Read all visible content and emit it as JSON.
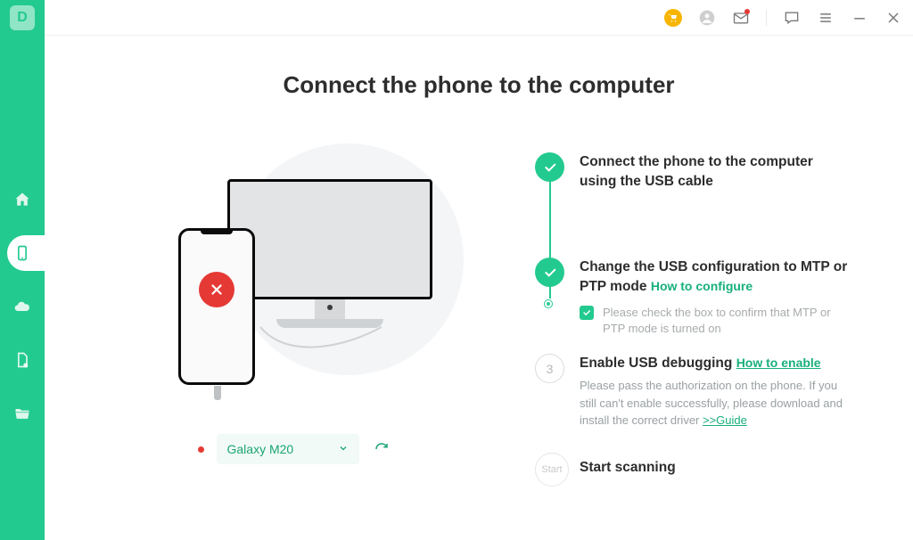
{
  "logo_letter": "D",
  "title": "Connect the phone to the computer",
  "device": {
    "name": "Galaxy M20"
  },
  "steps": {
    "s1": {
      "title": "Connect the phone to the computer using the USB cable"
    },
    "s2": {
      "title": "Change the USB configuration to MTP or PTP mode",
      "link": "How to configure",
      "checkbox_text": "Please  check the box to confirm that MTP or PTP mode is turned on"
    },
    "s3": {
      "num": "3",
      "title": "Enable USB debugging",
      "link": "How to enable",
      "sub": "Please pass the authorization on the phone. If you still can't enable successfully, please download and install the correct driver ",
      "guide": ">>Guide"
    },
    "s4": {
      "badge": "Start",
      "title": "Start scanning"
    }
  }
}
